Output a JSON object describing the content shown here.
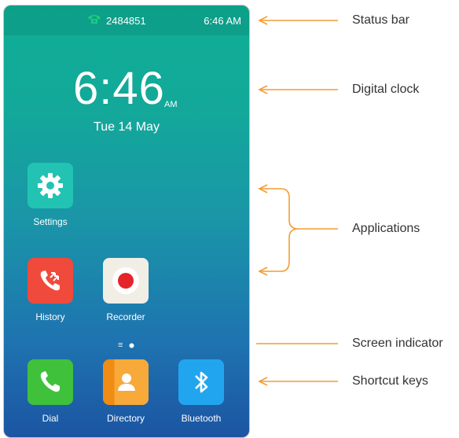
{
  "status_bar": {
    "phone_number": "2484851",
    "time": "6:46 AM"
  },
  "clock": {
    "time": "6:46",
    "ampm": "AM",
    "date": "Tue 14 May"
  },
  "apps": {
    "settings": "Settings",
    "history": "History",
    "recorder": "Recorder"
  },
  "screen_indicator": {
    "pages": 2,
    "current": 2
  },
  "shortcuts": {
    "dial": "Dial",
    "directory": "Directory",
    "bluetooth": "Bluetooth"
  },
  "callouts": {
    "status_bar": "Status bar",
    "digital_clock": "Digital clock",
    "applications": "Applications",
    "screen_indicator": "Screen indicator",
    "shortcut_keys": "Shortcut keys"
  },
  "colors": {
    "callout_arrow": "#f39c33",
    "status_phone_icon": "#19d07a"
  }
}
